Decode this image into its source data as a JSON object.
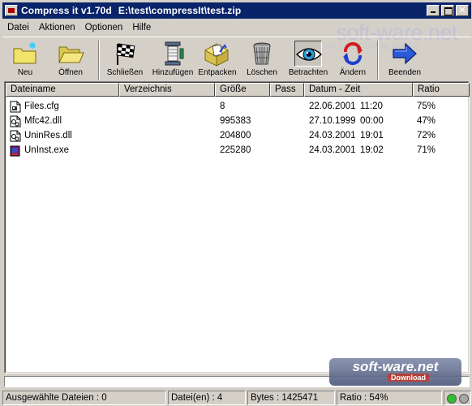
{
  "window": {
    "title": "Compress it v1.70d",
    "path": "E:\\test\\compressIt\\test.zip"
  },
  "menu": [
    "Datei",
    "Aktionen",
    "Optionen",
    "Hilfe"
  ],
  "logo": {
    "text": "soft-ware.net",
    "sub": "QUELLE DOWNLOADS"
  },
  "toolbar": [
    {
      "label": "Neu",
      "icon": "new-folder-icon"
    },
    {
      "label": "Öffnen",
      "icon": "open-folder-icon"
    },
    {
      "label": "Schließen",
      "icon": "checkered-flag-icon"
    },
    {
      "label": "Hinzufügen",
      "icon": "vise-icon"
    },
    {
      "label": "Entpacken",
      "icon": "unpack-icon"
    },
    {
      "label": "Löschen",
      "icon": "trash-icon"
    },
    {
      "label": "Betrachten",
      "icon": "eye-icon"
    },
    {
      "label": "Ändern",
      "icon": "refresh-icon"
    },
    {
      "label": "Beenden",
      "icon": "exit-arrow-icon"
    }
  ],
  "columns": [
    "Dateiname",
    "Verzeichnis",
    "Größe",
    "Pass",
    "Datum     -     Zeit",
    "Ratio"
  ],
  "files": [
    {
      "name": "Files.cfg",
      "dir": "",
      "size": "8",
      "pass": "",
      "date": "22.06.2001",
      "time": "11:20",
      "ratio": "75%",
      "icon": "config-file-icon"
    },
    {
      "name": "Mfc42.dll",
      "dir": "",
      "size": "995383",
      "pass": "",
      "date": "27.10.1999",
      "time": "00:00",
      "ratio": "47%",
      "icon": "dll-file-icon"
    },
    {
      "name": "UninRes.dll",
      "dir": "",
      "size": "204800",
      "pass": "",
      "date": "24.03.2001",
      "time": "19:01",
      "ratio": "72%",
      "icon": "dll-file-icon"
    },
    {
      "name": "UnInst.exe",
      "dir": "",
      "size": "225280",
      "pass": "",
      "date": "24.03.2001",
      "time": "19:02",
      "ratio": "71%",
      "icon": "exe-file-icon"
    }
  ],
  "status": {
    "selected": "Ausgewählte Dateien : 0",
    "files": "Datei(en) : 4",
    "bytes": "Bytes : 1425471",
    "ratio": "Ratio : 54%"
  },
  "watermark": {
    "text": "soft-ware.net",
    "sub": "Download"
  },
  "colors": {
    "titlebar": "#0a246a",
    "face": "#d4d0c8"
  }
}
